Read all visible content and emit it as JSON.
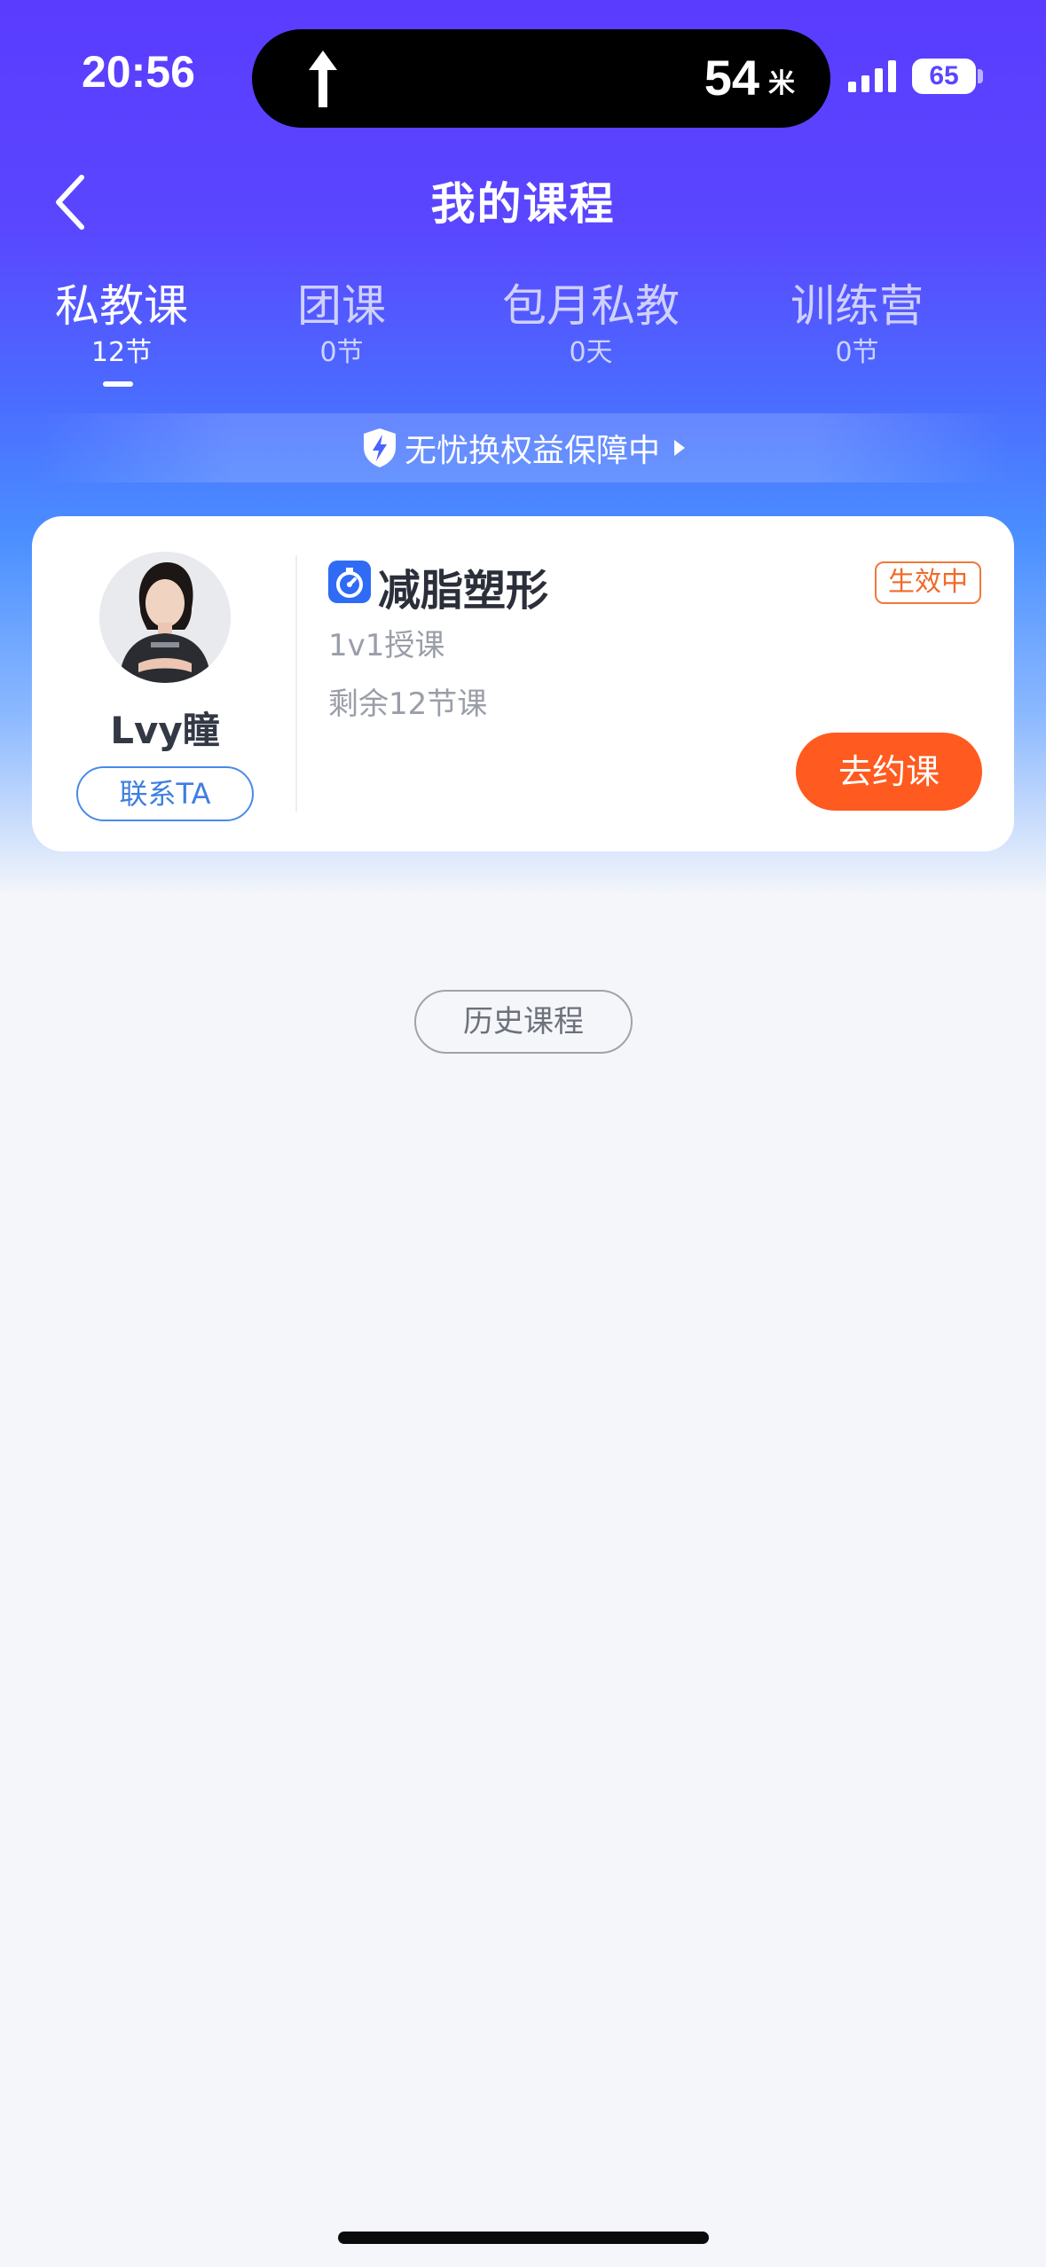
{
  "status_bar": {
    "time": "20:56",
    "distance": "54",
    "distance_unit": "米",
    "battery": "65"
  },
  "header": {
    "title": "我的课程"
  },
  "tabs": [
    {
      "label": "私教课",
      "count": "12节",
      "active": true
    },
    {
      "label": "团课",
      "count": "0节",
      "active": false
    },
    {
      "label": "包月私教",
      "count": "0天",
      "active": false
    },
    {
      "label": "训练营",
      "count": "0节",
      "active": false
    }
  ],
  "guarantee": {
    "text": "无忧换权益保障中"
  },
  "course_card": {
    "coach_name": "Lvy瞳",
    "contact_label": "联系TA",
    "course_name": "减脂塑形",
    "status": "生效中",
    "course_type": "1v1授课",
    "remaining": "剩余12节课",
    "book_label": "去约课"
  },
  "history": {
    "label": "历史课程"
  },
  "colors": {
    "brand": "#5a46ff",
    "accent": "#ff5a1f",
    "badge": "#f06a28",
    "link": "#3d7fe0"
  },
  "icons": [
    "navigation-arrow-icon",
    "signal-icon",
    "battery-icon",
    "back-arrow-icon",
    "shield-icon",
    "triangle-right-icon",
    "stopwatch-icon",
    "avatar-photo"
  ]
}
